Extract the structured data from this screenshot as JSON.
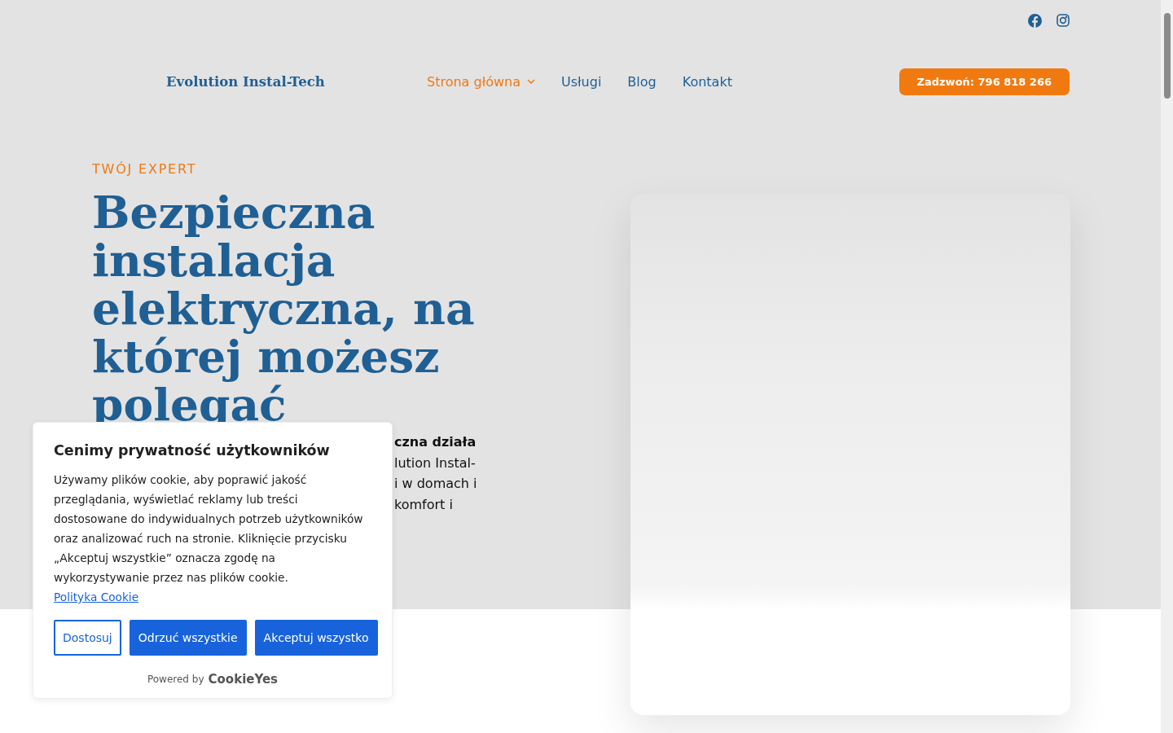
{
  "social": [
    {
      "kind": "facebook"
    },
    {
      "kind": "instagram"
    }
  ],
  "header": {
    "logo": "Evolution Instal-Tech",
    "nav": [
      {
        "label": "Strona główna",
        "selected": true,
        "dropdown": true
      },
      {
        "label": "Usługi",
        "selected": false,
        "dropdown": false
      },
      {
        "label": "Blog",
        "selected": false,
        "dropdown": false
      },
      {
        "label": "Kontakt",
        "selected": false,
        "dropdown": false
      }
    ],
    "call_button": "Zadzwoń: 796 818 266"
  },
  "hero": {
    "eyebrow": "TWÓJ EXPERT",
    "heading": "Bezpieczna instalacja elektryczna, na której możesz polegać",
    "paragraph_fragments": [
      {
        "text": "czna działa",
        "bold": true
      },
      {
        "text": "lution Instal-",
        "bold": false
      },
      {
        "text": "i w domach i",
        "bold": false
      },
      {
        "text": "komfort i",
        "bold": false
      }
    ]
  },
  "cookie_banner": {
    "title": "Cenimy prywatność użytkowników",
    "body": "Używamy plików cookie, aby poprawić jakość przeglądania, wyświetlać reklamy lub treści dostosowane do indywidualnych potrzeb użytkowników oraz analizować ruch na stronie. Kliknięcie przycisku „Akceptuj wszystkie” oznacza zgodę na wykorzystywanie przez nas plików cookie.",
    "link": "Polityka Cookie",
    "buttons": [
      {
        "label": "Dostosuj",
        "kind": "outline"
      },
      {
        "label": "Odrzuć wszystkie",
        "kind": "filled"
      },
      {
        "label": "Akceptuj wszystko",
        "kind": "filled"
      }
    ],
    "powered_by": "Powered by",
    "brand": "CookieYes"
  }
}
